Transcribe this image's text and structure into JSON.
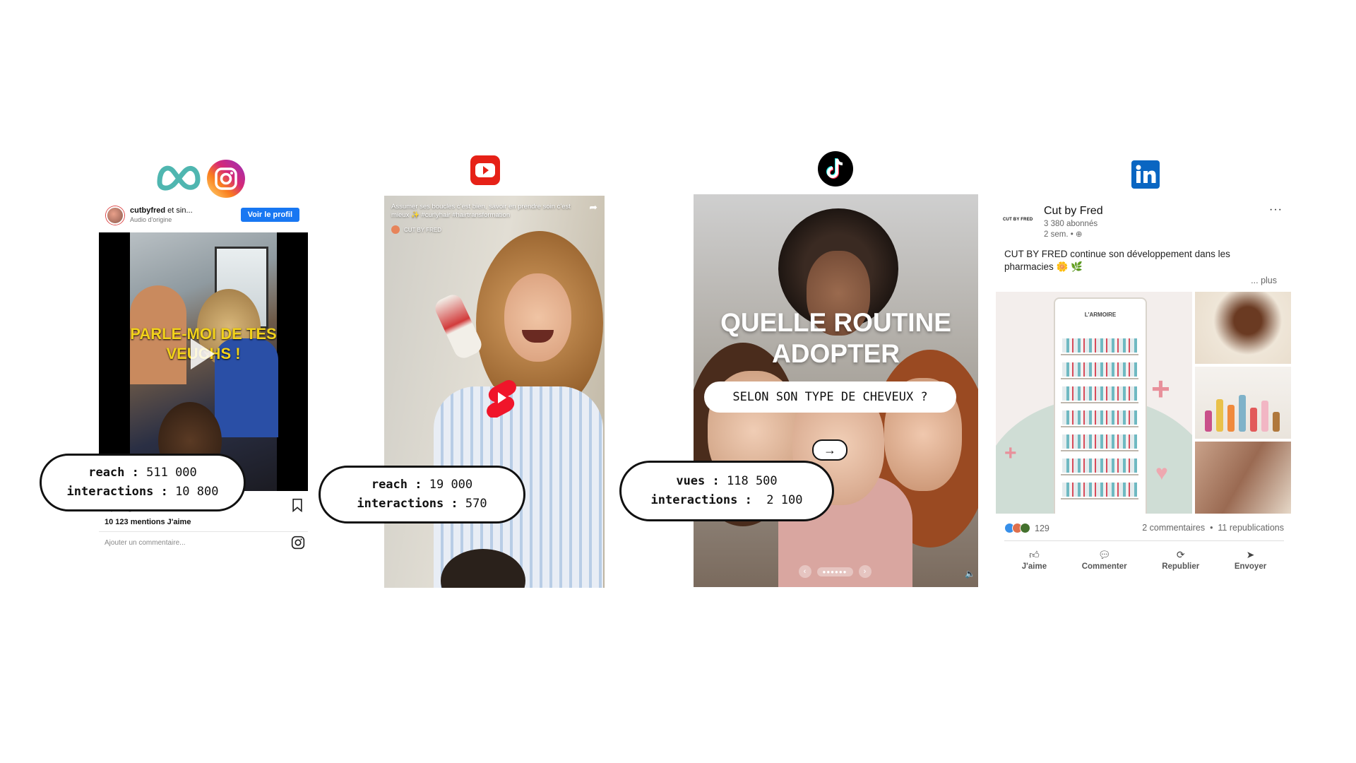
{
  "instagram": {
    "username": "cutbyfred",
    "username_suffix": " et sin...",
    "audio": "Audio d'origine",
    "follow_label": "Voir le profil",
    "overlay_text": "PARLE-MOI DE TES VEUCHS !",
    "likes": "10 123 mentions J'aime",
    "comment_placeholder": "Ajouter un commentaire...",
    "stats": {
      "reach_label": "reach",
      "reach_value": "511 000",
      "interactions_label": "interactions",
      "interactions_value": "10 800"
    }
  },
  "youtube": {
    "caption": "Assumer ses boucles c'est bien, savoir en prendre soin c'est mieux ✨ #curlyhair #hairtransformation",
    "channel": "CUT BY FRED",
    "stats": {
      "reach_label": "reach",
      "reach_value": "19 000",
      "interactions_label": "interactions",
      "interactions_value": "570"
    }
  },
  "tiktok": {
    "title": "QUELLE ROUTINE ADOPTER",
    "subtitle": "SELON SON TYPE DE CHEVEUX ?",
    "arrow": "→",
    "stats": {
      "reach_label": "vues",
      "reach_value": "118 500",
      "interactions_label": "interactions",
      "interactions_value": "2 100"
    }
  },
  "linkedin": {
    "logo_text": "CUT BY FRED",
    "company": "Cut by Fred",
    "followers": "3 380 abonnés",
    "age": "2 sem. • ⊕",
    "more": "···",
    "post_text": "CUT BY FRED continue son développement dans les pharmacies 🌼 🌿",
    "see_more": "... plus",
    "cabinet_label": "L'ARMOIRE",
    "reactions_count": "129",
    "comments": "2 commentaires",
    "reposts": "11 republications",
    "actions": [
      "J'aime",
      "Commenter",
      "Republier",
      "Envoyer"
    ]
  },
  "colors": {
    "ig_blue": "#1877f2",
    "yt_red": "#e62117",
    "linkedin_blue": "#0a66c2",
    "overlay_yellow": "#f2d21a"
  }
}
